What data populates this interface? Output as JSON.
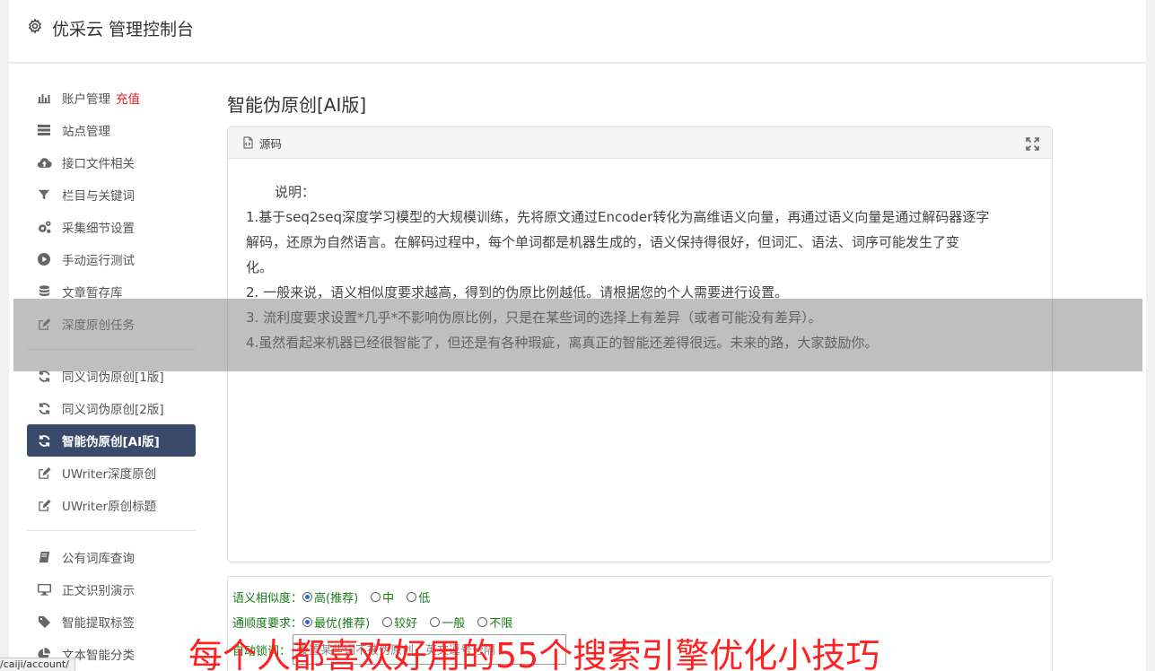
{
  "header": {
    "title": "优采云 管理控制台"
  },
  "sidebar": {
    "groups": [
      [
        {
          "label": "账户管理",
          "badge": "充值",
          "icon": "bar-chart-icon"
        },
        {
          "label": "站点管理",
          "icon": "server-icon"
        },
        {
          "label": "接口文件相关",
          "icon": "cloud-upload-icon"
        },
        {
          "label": "栏目与关键词",
          "icon": "filter-icon"
        },
        {
          "label": "采集细节设置",
          "icon": "cogs-icon"
        },
        {
          "label": "手动运行测试",
          "icon": "play-circle-icon"
        },
        {
          "label": "文章暂存库",
          "icon": "database-icon"
        },
        {
          "label": "深度原创任务",
          "icon": "edit-icon"
        }
      ],
      [
        {
          "label": "同义词伪原创[1版]",
          "icon": "refresh-icon"
        },
        {
          "label": "同义词伪原创[2版]",
          "icon": "refresh-icon"
        },
        {
          "label": "智能伪原创[AI版]",
          "icon": "refresh-icon",
          "active": true
        },
        {
          "label": "UWriter深度原创",
          "icon": "edit-icon"
        },
        {
          "label": "UWriter原创标题",
          "icon": "edit-icon"
        }
      ],
      [
        {
          "label": "公有词库查询",
          "icon": "book-icon"
        },
        {
          "label": "正文识别演示",
          "icon": "monitor-icon"
        },
        {
          "label": "智能提取标签",
          "icon": "tag-icon"
        },
        {
          "label": "文本智能分类",
          "icon": "pie-chart-icon"
        }
      ]
    ]
  },
  "main": {
    "title": "智能伪原创[AI版]",
    "panel": {
      "header": "源码",
      "lines": [
        "说明：",
        "1.基于seq2seq深度学习模型的大规模训练，先将原文通过Encoder转化为高维语义向量，再通过语义向量是通过解码器逐字",
        "解码，还原为自然语言。在解码过程中，每个单词都是机器生成的，语义保持得很好，但词汇、语法、词序可能发生了变",
        "化。",
        "2. 一般来说，语义相似度要求越高，得到的伪原比例越低。请根据您的个人需要进行设置。",
        "3. 流利度要求设置*几乎*不影响伪原比例，只是在某些词的选择上有差异（或者可能没有差异）。",
        "4.虽然看起来机器已经很智能了，但还是有各种瑕疵，离真正的智能还差得很远。未来的路，大家鼓励你。"
      ]
    },
    "form": {
      "similarity_label": "语义相似度：",
      "similarity_options": [
        "高(推荐)",
        "中",
        "低"
      ],
      "fluency_label": "通顺度要求：",
      "fluency_options": [
        "最优(推荐)",
        "较好",
        "一般",
        "不限"
      ],
      "lock_label": "自动锁词：",
      "lock_placeholder": "设置某些词不被伪原创，英文逗号分隔"
    }
  },
  "watermark": "每个人都喜欢好用的55个搜索引擎优化小技巧",
  "statusbar": "/caiji/account/"
}
